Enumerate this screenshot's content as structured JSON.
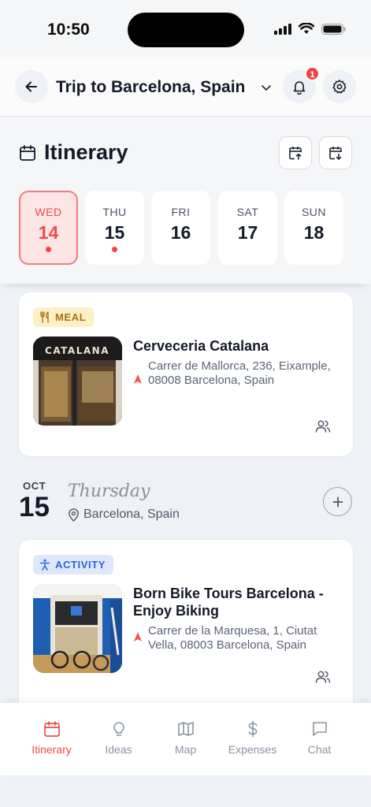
{
  "status_bar": {
    "time": "10:50"
  },
  "header": {
    "trip_title": "Trip to Barcelona, Spain",
    "notification_count": "1"
  },
  "itinerary": {
    "title": "Itinerary",
    "days": [
      {
        "name": "WED",
        "date": "14",
        "selected": true,
        "has_events": true
      },
      {
        "name": "THU",
        "date": "15",
        "selected": false,
        "has_events": true
      },
      {
        "name": "FRI",
        "date": "16",
        "selected": false,
        "has_events": false
      },
      {
        "name": "SAT",
        "date": "17",
        "selected": false,
        "has_events": false
      },
      {
        "name": "SUN",
        "date": "18",
        "selected": false,
        "has_events": false
      }
    ]
  },
  "cards": [
    {
      "tag": "MEAL",
      "name": "Cerveceria Catalana",
      "address": "Carrer de Mallorca, 236, Eixample, 08008 Barcelona, Spain",
      "sign_text": "CATALANA"
    },
    {
      "tag": "ACTIVITY",
      "name": "Born Bike Tours Barcelona - Enjoy Biking",
      "address": "Carrer de la Marquesa, 1, Ciutat Vella, 08003 Barcelona, Spain"
    }
  ],
  "day_header": {
    "month": "OCT",
    "day": "15",
    "weekday": "Thursday",
    "location": "Barcelona, Spain"
  },
  "tabbar": {
    "tabs": [
      {
        "label": "Itinerary",
        "icon": "calendar-icon",
        "active": true
      },
      {
        "label": "Ideas",
        "icon": "lightbulb-icon",
        "active": false
      },
      {
        "label": "Map",
        "icon": "map-icon",
        "active": false
      },
      {
        "label": "Expenses",
        "icon": "dollar-icon",
        "active": false
      },
      {
        "label": "Chat",
        "icon": "chat-icon",
        "active": false
      }
    ]
  },
  "colors": {
    "accent": "#ef4a4a",
    "meal_tag_bg": "#fdf0c6",
    "activity_tag_bg": "#dde8fc"
  }
}
